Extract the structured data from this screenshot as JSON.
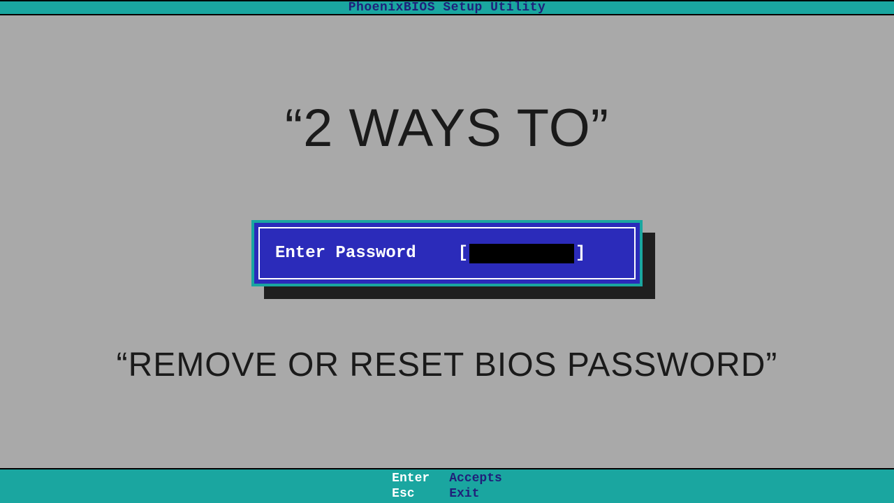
{
  "header": {
    "title": "PhoenixBIOS Setup Utility"
  },
  "overlay": {
    "headline1": "“2 WAYS TO”",
    "headline2": "“REMOVE OR RESET BIOS PASSWORD”"
  },
  "dialog": {
    "label": "Enter Password",
    "bracket_open": "[",
    "bracket_close": "]",
    "password_value": ""
  },
  "footer": {
    "hints": [
      {
        "key": "Enter",
        "action": "Accepts"
      },
      {
        "key": "Esc",
        "action": "Exit"
      }
    ]
  },
  "colors": {
    "teal": "#1aa6a0",
    "blue": "#2b2bba",
    "bg": "#a9a9a9"
  }
}
